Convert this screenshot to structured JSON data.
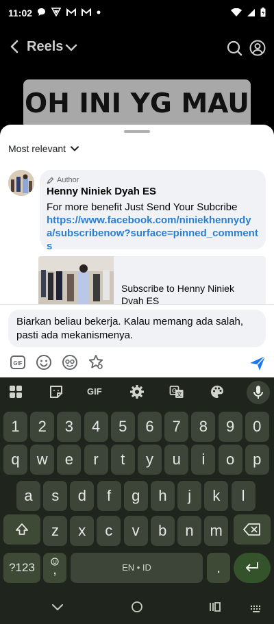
{
  "status": {
    "time": "11:02"
  },
  "header": {
    "title": "Reels"
  },
  "video": {
    "caption": "OH INI YG MAU"
  },
  "comments": {
    "sort_label": "Most relevant",
    "pinned": {
      "tag": "Author",
      "name": "Henny Niniek Dyah ES",
      "text": "For more benefit Just Send Your Subcribe",
      "link": "https://www.facebook.com/niniekhennydya/subscribenow?surface=pinned_comments"
    },
    "preview": {
      "title": "Subscribe to Henny Niniek Dyah ES"
    }
  },
  "composer": {
    "text": "Biarkan beliau bekerja. Kalau memang ada salah, pasti ada mekanismenya."
  },
  "keyboard": {
    "row_numbers": [
      "1",
      "2",
      "3",
      "4",
      "5",
      "6",
      "7",
      "8",
      "9",
      "0"
    ],
    "row_1": [
      "q",
      "w",
      "e",
      "r",
      "t",
      "y",
      "u",
      "i",
      "o",
      "p"
    ],
    "row_2": [
      "a",
      "s",
      "d",
      "f",
      "g",
      "h",
      "j",
      "k",
      "l"
    ],
    "row_3": [
      "z",
      "x",
      "c",
      "v",
      "b",
      "n",
      "m"
    ],
    "symbols_label": "?123",
    "emoji_label": ",",
    "space_label": "EN • ID",
    "period_label": ".",
    "gif_label": "GIF"
  },
  "colors": {
    "link": "#2a7fd4",
    "send": "#1877f2",
    "keyboard_bg": "#1f241d"
  }
}
